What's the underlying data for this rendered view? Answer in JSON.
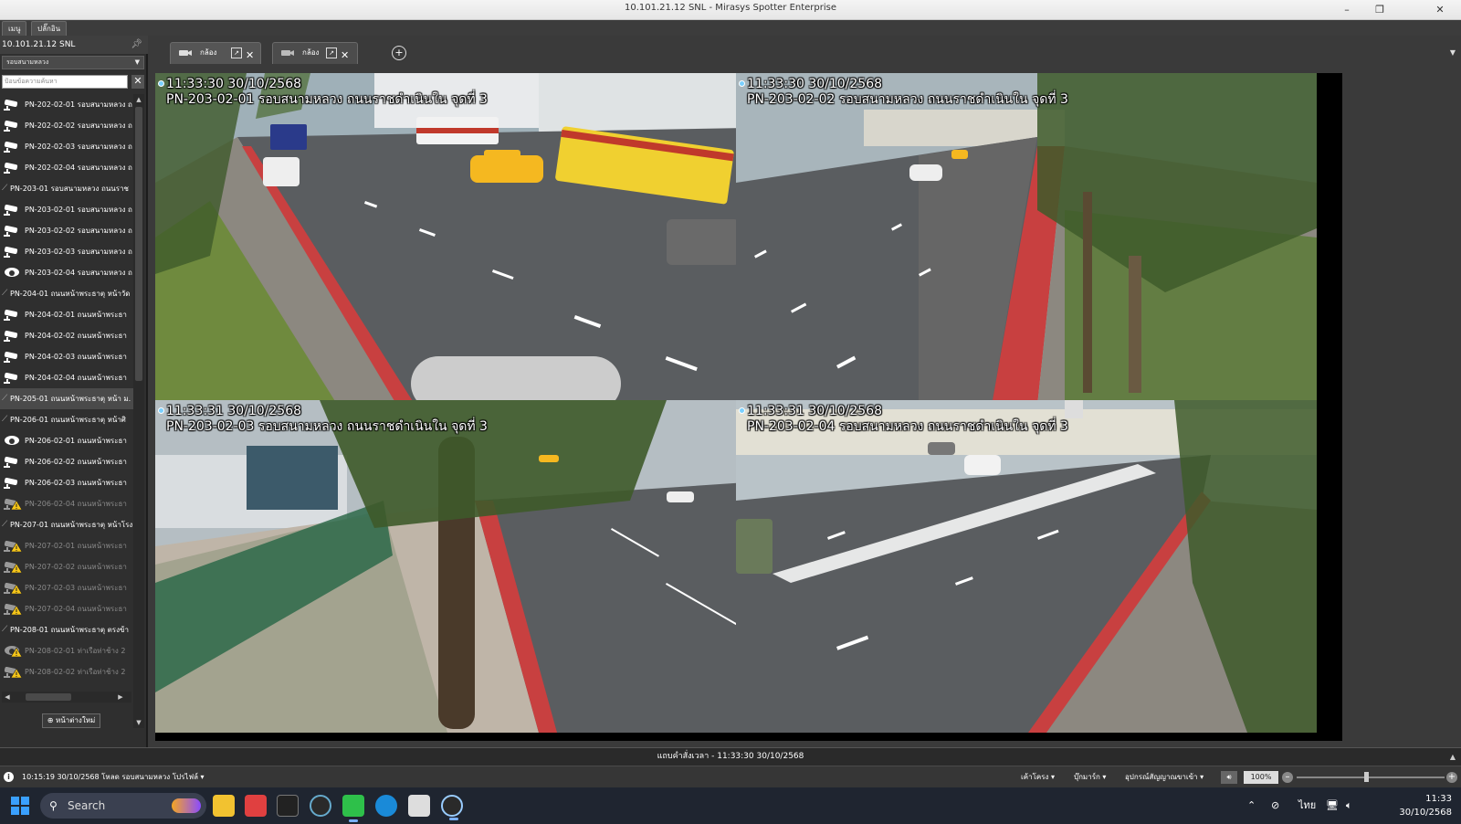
{
  "window": {
    "title": "10.101.21.12 SNL - Mirasys Spotter Enterprise",
    "minimize": "–",
    "maximize": "❐",
    "close": "✕"
  },
  "menu_tabs": [
    "เมนู",
    "ปลั๊กอิน"
  ],
  "left_panel": {
    "server": "10.101.21.12 SNL",
    "group_select": "รอบสนามหลวง",
    "search_placeholder": "ป้อนข้อความค้นหา",
    "items": [
      {
        "kind": "cam",
        "label": "PN-202-02-01 รอบสนามหลวง ถ",
        "state": "ok",
        "icon": "bullet-camera-icon"
      },
      {
        "kind": "cam",
        "label": "PN-202-02-02 รอบสนามหลวง ถ",
        "state": "ok",
        "icon": "bullet-camera-icon"
      },
      {
        "kind": "cam",
        "label": "PN-202-02-03 รอบสนามหลวง ถ",
        "state": "ok",
        "icon": "bullet-camera-icon"
      },
      {
        "kind": "cam",
        "label": "PN-202-02-04 รอบสนามหลวง ถ",
        "state": "ok",
        "icon": "bullet-camera-icon"
      },
      {
        "kind": "group",
        "label": "PN-203-01 รอบสนามหลวง ถนนราช",
        "state": "ok"
      },
      {
        "kind": "cam",
        "label": "PN-203-02-01 รอบสนามหลวง ถ",
        "state": "ok",
        "icon": "bullet-camera-icon"
      },
      {
        "kind": "cam",
        "label": "PN-203-02-02 รอบสนามหลวง ถ",
        "state": "ok",
        "icon": "bullet-camera-icon"
      },
      {
        "kind": "cam",
        "label": "PN-203-02-03 รอบสนามหลวง ถ",
        "state": "ok",
        "icon": "bullet-camera-icon"
      },
      {
        "kind": "cam",
        "label": "PN-203-02-04 รอบสนามหลวง ถ",
        "state": "ok",
        "icon": "dome-camera-icon"
      },
      {
        "kind": "group",
        "label": "PN-204-01 ถนนหน้าพระธาตุ หน้าวัด",
        "state": "ok"
      },
      {
        "kind": "cam",
        "label": "PN-204-02-01 ถนนหน้าพระธา",
        "state": "ok",
        "icon": "bullet-camera-icon"
      },
      {
        "kind": "cam",
        "label": "PN-204-02-02 ถนนหน้าพระธา",
        "state": "ok",
        "icon": "bullet-camera-icon"
      },
      {
        "kind": "cam",
        "label": "PN-204-02-03 ถนนหน้าพระธา",
        "state": "ok",
        "icon": "bullet-camera-icon"
      },
      {
        "kind": "cam",
        "label": "PN-204-02-04 ถนนหน้าพระธา",
        "state": "ok",
        "icon": "bullet-camera-icon"
      },
      {
        "kind": "group",
        "label": "PN-205-01 ถนนหน้าพระธาตุ หน้า ม.",
        "state": "selected"
      },
      {
        "kind": "group",
        "label": "PN-206-01 ถนนหน้าพระธาตุ หน้าศิ",
        "state": "ok"
      },
      {
        "kind": "cam",
        "label": "PN-206-02-01 ถนนหน้าพระธา",
        "state": "ok",
        "icon": "dome-camera-icon"
      },
      {
        "kind": "cam",
        "label": "PN-206-02-02 ถนนหน้าพระธา",
        "state": "ok",
        "icon": "bullet-camera-icon"
      },
      {
        "kind": "cam",
        "label": "PN-206-02-03 ถนนหน้าพระธา",
        "state": "ok",
        "icon": "bullet-camera-icon"
      },
      {
        "kind": "cam",
        "label": "PN-206-02-04 ถนนหน้าพระธา",
        "state": "warn",
        "icon": "bullet-camera-warning-icon"
      },
      {
        "kind": "group",
        "label": "PN-207-01 ถนนหน้าพระธาตุ หน้าโรง",
        "state": "ok"
      },
      {
        "kind": "cam",
        "label": "PN-207-02-01 ถนนหน้าพระธา",
        "state": "warn",
        "icon": "bullet-camera-warning-icon"
      },
      {
        "kind": "cam",
        "label": "PN-207-02-02 ถนนหน้าพระธา",
        "state": "warn",
        "icon": "bullet-camera-warning-icon"
      },
      {
        "kind": "cam",
        "label": "PN-207-02-03 ถนนหน้าพระธา",
        "state": "warn",
        "icon": "bullet-camera-warning-icon"
      },
      {
        "kind": "cam",
        "label": "PN-207-02-04 ถนนหน้าพระธา",
        "state": "warn",
        "icon": "bullet-camera-warning-icon"
      },
      {
        "kind": "group",
        "label": "PN-208-01 ถนนหน้าพระธาตุ ตรงข้า",
        "state": "ok"
      },
      {
        "kind": "cam",
        "label": "PN-208-02-01 ท่าเรือท่าช้าง 2",
        "state": "warn",
        "icon": "dome-camera-warning-icon"
      },
      {
        "kind": "cam",
        "label": "PN-208-02-02 ท่าเรือท่าช้าง 2",
        "state": "warn",
        "icon": "bullet-camera-warning-icon"
      }
    ],
    "new_button": "หน้าต่างใหม่"
  },
  "view_tabs": [
    {
      "label": "กล้อง",
      "active": true
    },
    {
      "label": "กล้อง",
      "active": false
    }
  ],
  "tiles": [
    {
      "time": "11:33:30  30/10/2568",
      "name": "PN-203-02-01 รอบสนามหลวง ถนนราชดำเนินใน จุดที่ 3",
      "scene": "road-left"
    },
    {
      "time": "11:33:30  30/10/2568",
      "name": "PN-203-02-02 รอบสนามหลวง ถนนราชดำเนินใน จุดที่ 3",
      "scene": "road-right"
    },
    {
      "time": "11:33:31  30/10/2568",
      "name": "PN-203-02-03 รอบสนามหลวง ถนนราชดำเนินใน จุดที่ 3",
      "scene": "sidewalk"
    },
    {
      "time": "11:33:31  30/10/2568",
      "name": "PN-203-02-04 รอบสนามหลวง ถนนราชดำเนินใน จุดที่ 3",
      "scene": "curve"
    }
  ],
  "timeline": "แถบคำสั่งเวลา - 11:33:30  30/10/2568",
  "status": {
    "message": "10:15:19  30/10/2568 โหลด รอบสนามหลวง โปรไฟล์ ▾",
    "buttons": [
      "เค้าโครง ▾",
      "บุ๊กมาร์ก ▾",
      "อุปกรณ์สัญญาณขาเข้า ▾"
    ],
    "zoom": "100%"
  },
  "taskbar": {
    "search": "Search",
    "lang": "ไทย",
    "time": "11:33",
    "date": "30/10/2568"
  }
}
